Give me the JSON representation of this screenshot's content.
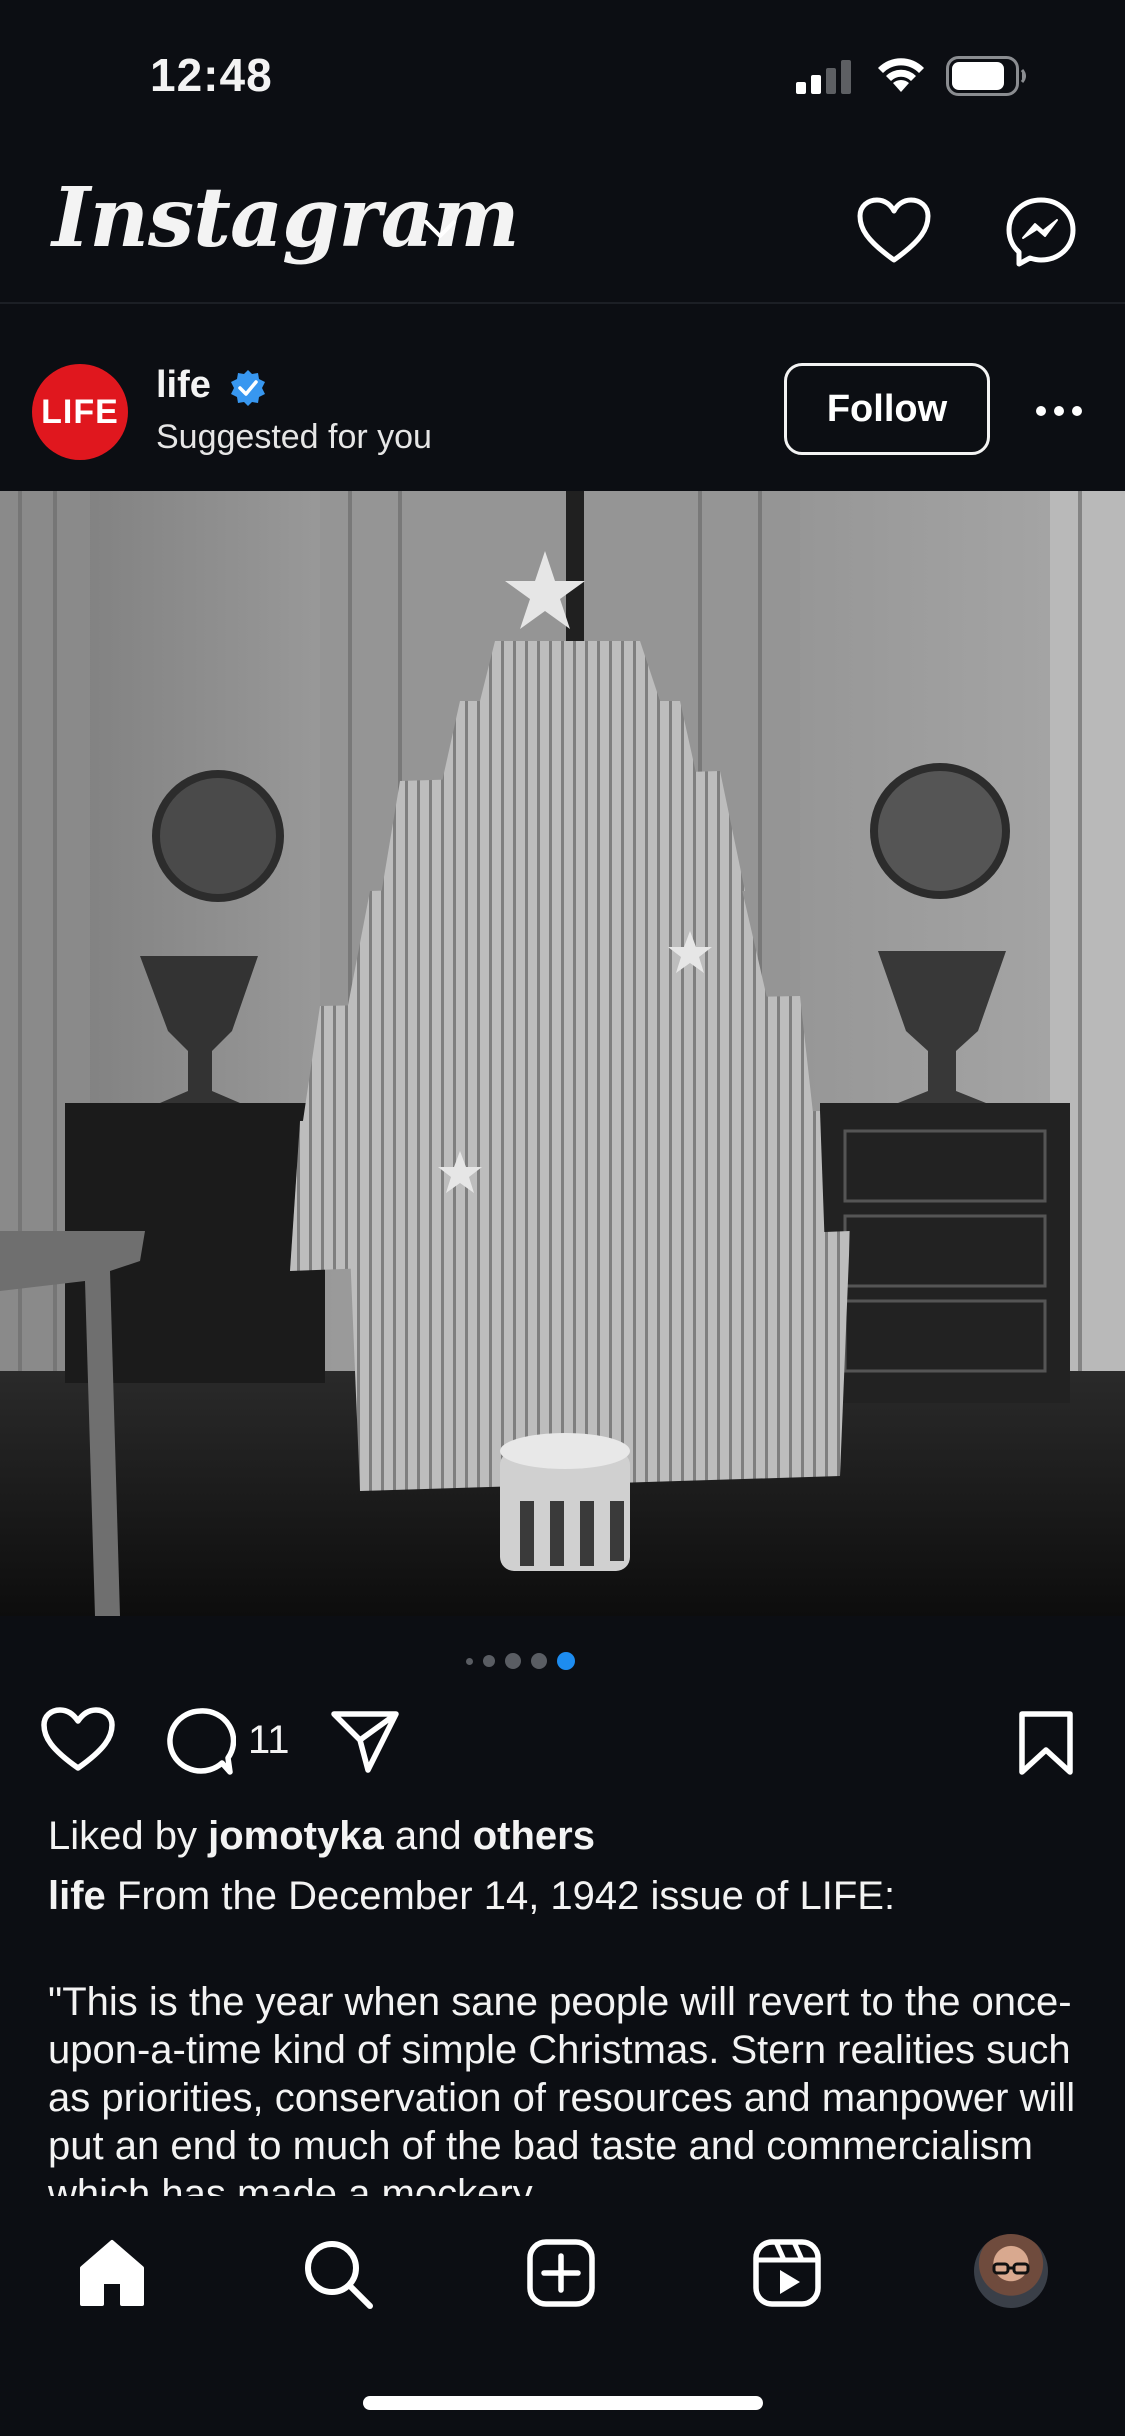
{
  "status": {
    "time": "12:48"
  },
  "header": {
    "logo_text": "Instagram"
  },
  "post": {
    "username": "life",
    "subtitle": "Suggested for you",
    "avatar_text": "LIFE",
    "follow_label": "Follow",
    "carousel": {
      "count": 5,
      "active_index": 4
    },
    "comment_count": "11",
    "liked_by_prefix": "Liked by",
    "liked_by_user": "jomotyka",
    "liked_by_and": "and",
    "liked_by_others": "others",
    "caption_user": "life",
    "caption_first": "From the December 14, 1942 issue of LIFE:",
    "caption_body": "\"This is the year when sane people will revert to the once-upon-a-time kind of simple Christmas. Stern realities such as priorities, conservation of resources and manpower will put an end to much of the bad taste and commercialism which has made a mockery"
  },
  "colors": {
    "background": "#0c0e13",
    "verified": "#3897f0",
    "brand_red": "#e0171e",
    "active_dot": "#1d8cf0"
  },
  "nav": {
    "items": [
      "home-icon",
      "search-icon",
      "create-icon",
      "reels-icon",
      "profile-avatar"
    ]
  }
}
